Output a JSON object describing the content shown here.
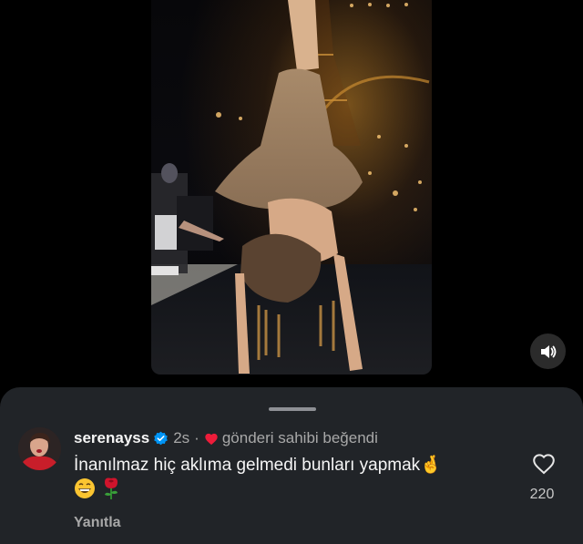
{
  "media": {
    "icon": "video-frame-runway-handstand"
  },
  "mute_button": {
    "icon": "speaker-icon"
  },
  "comment": {
    "username": "serenayss",
    "verified_icon": "verified-badge-icon",
    "time": "2s",
    "separator": "·",
    "liked_icon": "heart-icon",
    "liked_by_text": "gönderi sahibi beğendi",
    "text": "İnanılmaz hiç aklıma gelmedi bunları yapmak🤞",
    "emojis": [
      "😁",
      "🌹"
    ],
    "reply_label": "Yanıtla",
    "like_count": "220"
  },
  "colors": {
    "sheet_bg": "#212428",
    "verified_blue": "#0095f6",
    "heart_red": "#ed1c3a",
    "secondary_text": "#a8a8a8"
  }
}
